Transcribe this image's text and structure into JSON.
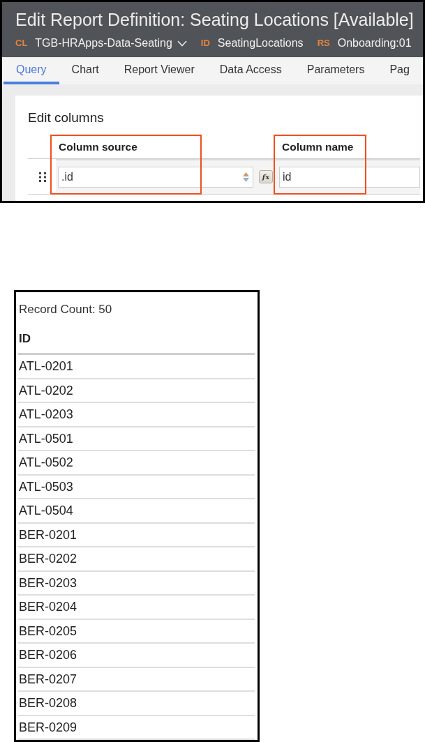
{
  "header": {
    "title": "Edit Report Definition: Seating Locations [Available]",
    "meta": [
      {
        "tag": "CL",
        "value": "TGB-HRApps-Data-Seating",
        "dropdown": true
      },
      {
        "tag": "ID",
        "value": "SeatingLocations",
        "dropdown": false
      },
      {
        "tag": "RS",
        "value": "Onboarding:01",
        "dropdown": false
      }
    ]
  },
  "tabs": [
    {
      "label": "Query",
      "selected": true
    },
    {
      "label": "Chart",
      "selected": false
    },
    {
      "label": "Report Viewer",
      "selected": false
    },
    {
      "label": "Data Access",
      "selected": false
    },
    {
      "label": "Parameters",
      "selected": false
    },
    {
      "label": "Pag",
      "selected": false
    }
  ],
  "edit_columns": {
    "title": "Edit columns",
    "columns": [
      {
        "label": "Column source",
        "highlighted": true
      },
      {
        "label": "Column name",
        "highlighted": true
      }
    ],
    "rows": [
      {
        "source": ".id",
        "formula_button": "fx",
        "name": "id"
      }
    ]
  },
  "report": {
    "record_count": "Record Count: 50",
    "columns": [
      {
        "label": "ID"
      }
    ],
    "rows": [
      {
        "id": "ATL-0201"
      },
      {
        "id": "ATL-0202"
      },
      {
        "id": "ATL-0203"
      },
      {
        "id": "ATL-0501"
      },
      {
        "id": "ATL-0502"
      },
      {
        "id": "ATL-0503"
      },
      {
        "id": "ATL-0504"
      },
      {
        "id": "BER-0201"
      },
      {
        "id": "BER-0202"
      },
      {
        "id": "BER-0203"
      },
      {
        "id": "BER-0204"
      },
      {
        "id": "BER-0205"
      },
      {
        "id": "BER-0206"
      },
      {
        "id": "BER-0207"
      },
      {
        "id": "BER-0208"
      },
      {
        "id": "BER-0209"
      }
    ]
  }
}
